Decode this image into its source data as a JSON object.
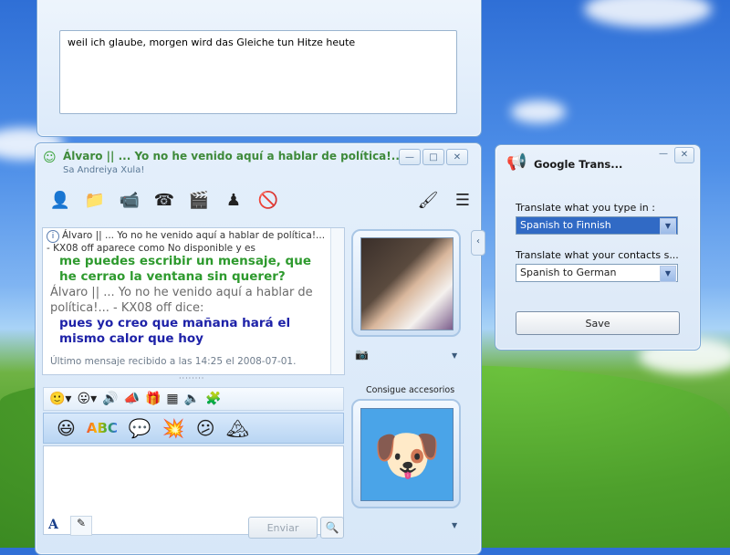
{
  "top_window": {
    "text": "weil ich glaube, morgen wird das Gleiche tun Hitze heute"
  },
  "chat_window": {
    "title": "Álvaro || ...  Yo no he venido aquí a hablar de política!......",
    "subtitle": "Sa Andreiya Xula!",
    "info_line": "Álvaro || ...   Yo no he venido aquí a hablar de política!... - KX08 off aparece como No disponible y es",
    "messages": {
      "m1": "me puedes escribir un mensaje, que he cerrao la ventana sin querer?",
      "sender": "Álvaro || ...  Yo no he venido aquí a hablar de política!... - KX08 off dice:",
      "m2": "pues yo creo que mañana hará el mismo calor que hoy"
    },
    "last_message": "Último mensaje recibido a las 14:25 el 2008-07-01.",
    "accessories_label": "Consigue accesorios",
    "send_label": "Enviar",
    "font_label": "A"
  },
  "google_translate": {
    "title": "Google Trans...",
    "label_you": "Translate what you type in :",
    "select_you": "Spanish to Finnish",
    "label_contacts": "Translate what your contacts s...",
    "select_contacts": "Spanish to German",
    "save_label": "Save"
  }
}
